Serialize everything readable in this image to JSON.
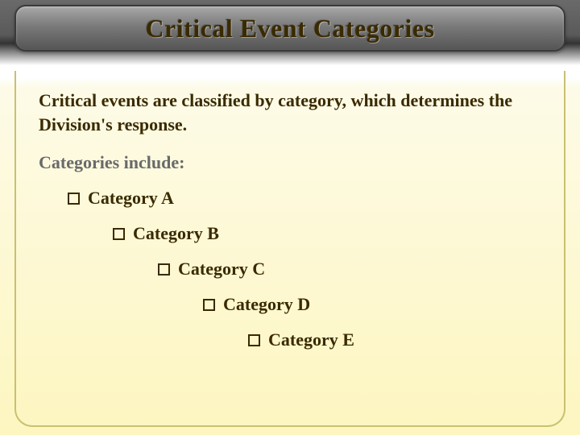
{
  "title": "Critical Event Categories",
  "intro": "Critical events are classified by category, which determines the Division's response.",
  "subhead": "Categories include:",
  "categories": [
    {
      "label": "Category A"
    },
    {
      "label": "Category B"
    },
    {
      "label": "Category C"
    },
    {
      "label": "Category D"
    },
    {
      "label": "Category E"
    }
  ],
  "colors": {
    "title_text": "#3a2a00",
    "body_text": "#3a2a00",
    "subhead_text": "#6a6a6a",
    "panel_border": "#c9c070"
  }
}
